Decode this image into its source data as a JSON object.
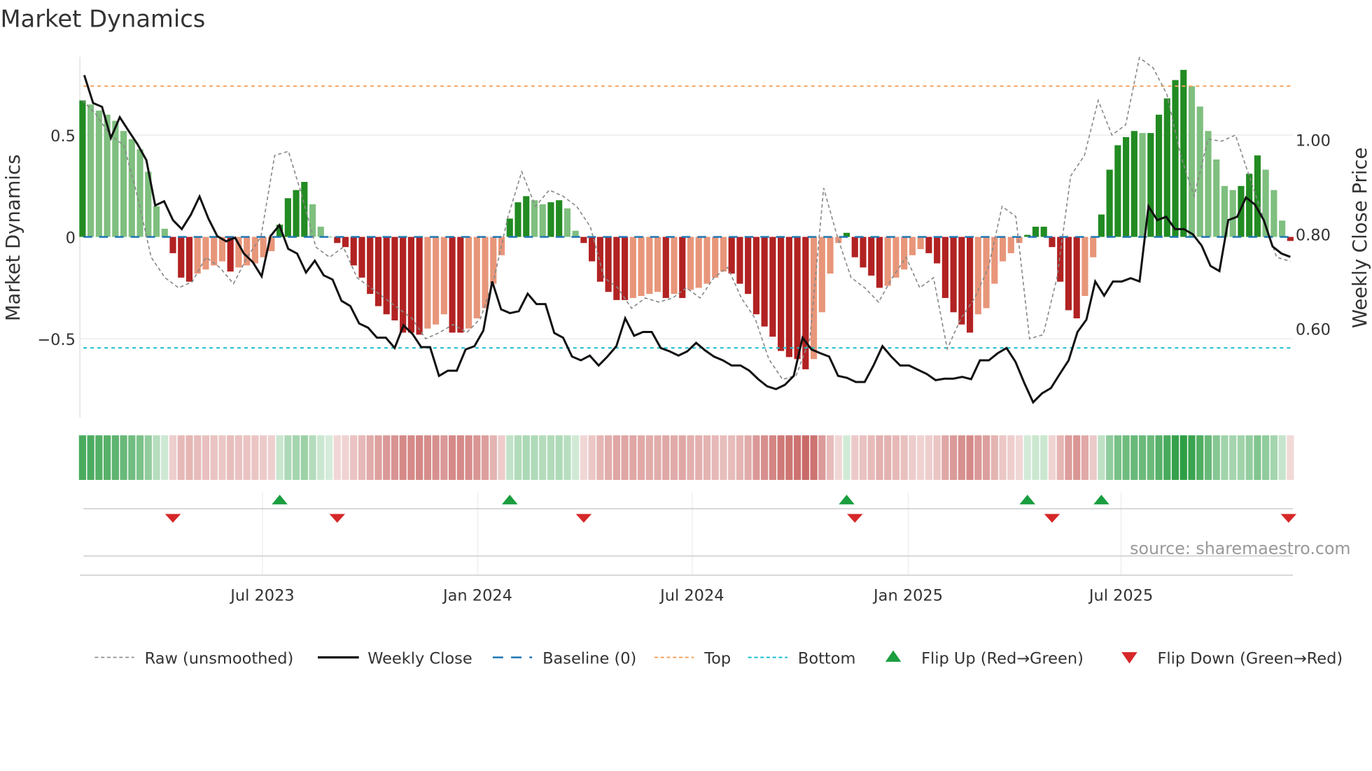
{
  "chart_data": {
    "type": "bar",
    "title": "Market Dynamics",
    "ylabel": "Market Dynamics",
    "y2label": "Weekly Close Price",
    "ylim": [
      -0.9,
      0.88
    ],
    "y2lim": [
      0.43,
      1.19
    ],
    "yticks": [
      {
        "v": 0.5,
        "label": "0.5"
      },
      {
        "v": 0,
        "label": "0"
      },
      {
        "v": -0.5,
        "label": "−0.5"
      }
    ],
    "y2ticks": [
      {
        "v": 1.0,
        "label": "1.00"
      },
      {
        "v": 0.8,
        "label": "0.80"
      },
      {
        "v": 0.6,
        "label": "0.60"
      }
    ],
    "xticks": [
      {
        "week": 21.9,
        "label": "Jul 2023"
      },
      {
        "week": 48.1,
        "label": "Jan 2024"
      },
      {
        "week": 74.2,
        "label": "Jul 2024"
      },
      {
        "week": 100.5,
        "label": "Jan 2025"
      },
      {
        "week": 126.4,
        "label": "Jul 2025"
      }
    ],
    "top_level": 0.74,
    "bottom_level": -0.545,
    "baseline": 0,
    "momentum": [
      0.67,
      0.65,
      0.62,
      0.6,
      0.57,
      0.52,
      0.48,
      0.43,
      0.32,
      0.15,
      0.04,
      -0.08,
      -0.2,
      -0.22,
      -0.18,
      -0.16,
      -0.14,
      -0.12,
      -0.17,
      -0.15,
      -0.14,
      -0.13,
      -0.1,
      -0.07,
      0.06,
      0.19,
      0.23,
      0.27,
      0.16,
      0.05,
      0.0,
      -0.03,
      -0.05,
      -0.14,
      -0.2,
      -0.28,
      -0.34,
      -0.38,
      -0.41,
      -0.47,
      -0.47,
      -0.48,
      -0.45,
      -0.43,
      -0.38,
      -0.47,
      -0.47,
      -0.45,
      -0.4,
      -0.35,
      -0.23,
      -0.09,
      0.09,
      0.17,
      0.2,
      0.18,
      0.16,
      0.17,
      0.18,
      0.14,
      0.03,
      -0.03,
      -0.12,
      -0.22,
      -0.27,
      -0.31,
      -0.31,
      -0.3,
      -0.29,
      -0.28,
      -0.27,
      -0.3,
      -0.28,
      -0.3,
      -0.26,
      -0.25,
      -0.23,
      -0.2,
      -0.17,
      -0.18,
      -0.23,
      -0.28,
      -0.38,
      -0.44,
      -0.49,
      -0.56,
      -0.59,
      -0.6,
      -0.65,
      -0.6,
      -0.37,
      -0.18,
      -0.03,
      0.02,
      -0.1,
      -0.15,
      -0.19,
      -0.25,
      -0.24,
      -0.2,
      -0.16,
      -0.09,
      -0.06,
      -0.08,
      -0.13,
      -0.3,
      -0.37,
      -0.43,
      -0.47,
      -0.38,
      -0.35,
      -0.23,
      -0.12,
      -0.08,
      -0.03,
      0.01,
      0.05,
      0.05,
      -0.05,
      -0.22,
      -0.36,
      -0.4,
      -0.29,
      -0.1,
      0.11,
      0.33,
      0.45,
      0.49,
      0.52,
      0.51,
      0.51,
      0.6,
      0.68,
      0.77,
      0.82,
      0.74,
      0.64,
      0.52,
      0.38,
      0.25,
      0.23,
      0.25,
      0.31,
      0.4,
      0.33,
      0.23,
      0.08,
      -0.02
    ],
    "raw": [
      0.67,
      0.6,
      0.5,
      0.45,
      0.2,
      -0.1,
      -0.2,
      -0.25,
      -0.22,
      -0.1,
      -0.15,
      -0.23,
      -0.1,
      0.0,
      0.4,
      0.42,
      0.2,
      -0.05,
      -0.1,
      -0.05,
      -0.2,
      -0.25,
      -0.3,
      -0.35,
      -0.4,
      -0.5,
      -0.47,
      -0.43,
      -0.47,
      -0.4,
      -0.2,
      0.1,
      0.32,
      0.15,
      0.23,
      0.2,
      0.15,
      0.05,
      -0.2,
      -0.25,
      -0.35,
      -0.3,
      -0.32,
      -0.3,
      -0.25,
      -0.3,
      -0.2,
      -0.15,
      -0.3,
      -0.4,
      -0.6,
      -0.7,
      -0.68,
      -0.5,
      0.24,
      0.0,
      -0.2,
      -0.25,
      -0.32,
      -0.2,
      -0.1,
      -0.25,
      -0.2,
      -0.55,
      -0.4,
      -0.3,
      -0.15,
      0.15,
      0.1,
      -0.5,
      -0.48,
      -0.2,
      0.3,
      0.4,
      0.67,
      0.5,
      0.55,
      0.88,
      0.83,
      0.7,
      0.4,
      0.2,
      0.48,
      0.47,
      0.5,
      0.3,
      0.1,
      -0.1,
      -0.12
    ],
    "close": [
      1.137,
      1.078,
      1.07,
      1.004,
      1.048,
      1.019,
      0.991,
      0.957,
      0.861,
      0.87,
      0.83,
      0.811,
      0.841,
      0.88,
      0.833,
      0.796,
      0.785,
      0.793,
      0.759,
      0.741,
      0.711,
      0.796,
      0.819,
      0.769,
      0.759,
      0.719,
      0.744,
      0.713,
      0.704,
      0.659,
      0.648,
      0.611,
      0.602,
      0.581,
      0.581,
      0.559,
      0.607,
      0.589,
      0.561,
      0.561,
      0.5,
      0.511,
      0.511,
      0.556,
      0.563,
      0.596,
      0.7,
      0.641,
      0.633,
      0.637,
      0.674,
      0.652,
      0.652,
      0.591,
      0.581,
      0.541,
      0.533,
      0.543,
      0.522,
      0.541,
      0.563,
      0.622,
      0.585,
      0.593,
      0.593,
      0.559,
      0.552,
      0.543,
      0.552,
      0.57,
      0.554,
      0.541,
      0.533,
      0.522,
      0.522,
      0.511,
      0.493,
      0.478,
      0.472,
      0.481,
      0.5,
      0.581,
      0.556,
      0.548,
      0.541,
      0.5,
      0.496,
      0.487,
      0.487,
      0.522,
      0.563,
      0.541,
      0.522,
      0.522,
      0.513,
      0.504,
      0.491,
      0.494,
      0.494,
      0.498,
      0.493,
      0.533,
      0.533,
      0.548,
      0.559,
      0.53,
      0.485,
      0.444,
      0.463,
      0.474,
      0.504,
      0.533,
      0.593,
      0.619,
      0.7,
      0.67,
      0.7,
      0.7,
      0.707,
      0.7,
      0.859,
      0.83,
      0.837,
      0.811,
      0.811,
      0.8,
      0.776,
      0.733,
      0.722,
      0.83,
      0.837,
      0.878,
      0.863,
      0.83,
      0.774,
      0.759,
      0.752
    ],
    "flip_up_weeks": [
      24,
      52,
      93,
      115,
      124
    ],
    "flip_down_weeks": [
      11,
      31,
      61,
      94,
      118,
      147
    ],
    "legend": [
      {
        "key": "raw",
        "label": "Raw (unsmoothed)"
      },
      {
        "key": "close",
        "label": "Weekly Close"
      },
      {
        "key": "baseline",
        "label": "Baseline (0)"
      },
      {
        "key": "top",
        "label": "Top"
      },
      {
        "key": "bottom",
        "label": "Bottom"
      },
      {
        "key": "flip_up",
        "label": "Flip Up (Red→Green)"
      },
      {
        "key": "flip_down",
        "label": "Flip Down (Green→Red)"
      }
    ],
    "legend_placement": "bottom",
    "colors": {
      "green_strong": "#228b22",
      "green_weak": "#7fbf7f",
      "red_strong": "#b22222",
      "red_weak": "#e8967a",
      "close": "#111111",
      "raw": "#888888",
      "baseline": "#1f77b4",
      "top": "#f4a460",
      "bottom": "#17becf",
      "flip_up": "#1a9e3f",
      "flip_down": "#d62728"
    }
  },
  "watermark": "source: sharemaestro.com"
}
